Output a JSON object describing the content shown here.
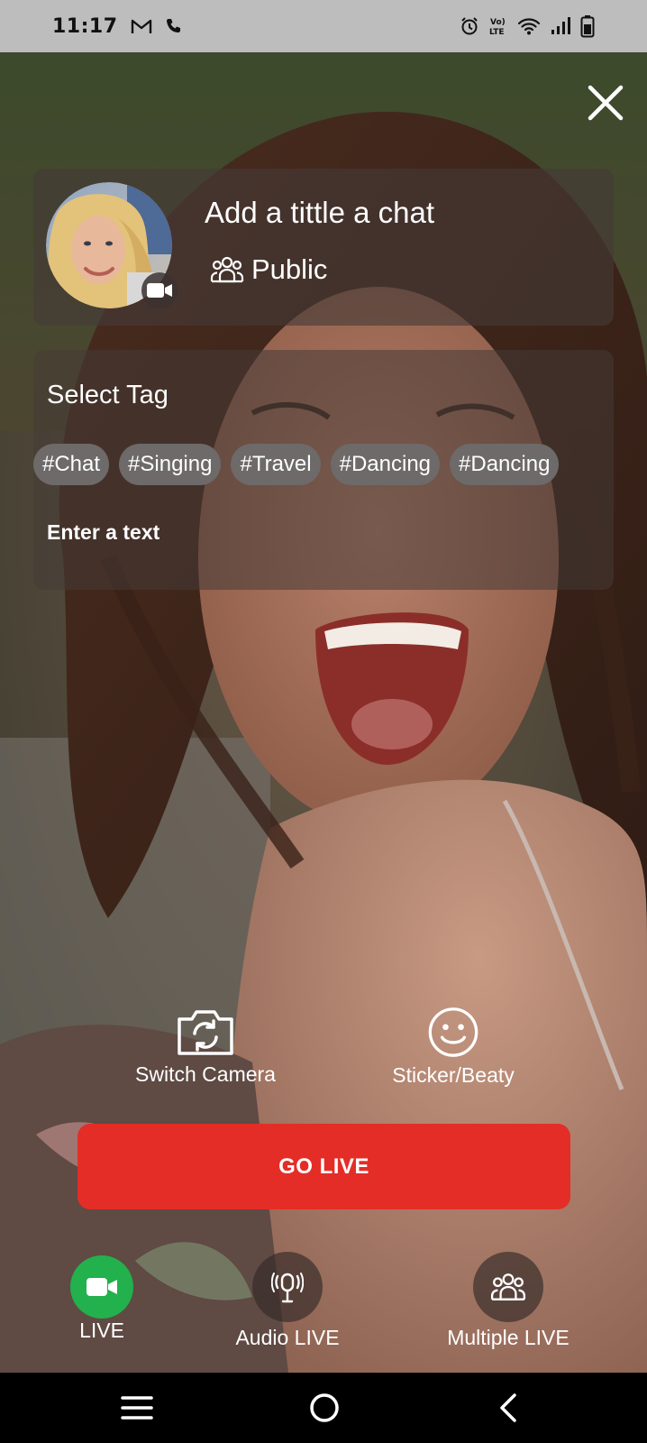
{
  "status_bar": {
    "time": "11:17",
    "left_icons": [
      "gmail-icon",
      "phone-icon"
    ],
    "right_icons": [
      "alarm-icon",
      "volte-icon",
      "wifi-icon",
      "signal-icon",
      "battery-icon"
    ],
    "volte_text": "Vo) LTE"
  },
  "stream": {
    "title": "Add a tittle a chat",
    "privacy": "Public"
  },
  "tags": {
    "label": "Select Tag",
    "items": [
      "#Chat",
      "#Singing",
      "#Travel",
      "#Dancing",
      "#Dancing"
    ],
    "text_placeholder": "Enter a text"
  },
  "tools": {
    "switch_camera": "Switch Camera",
    "sticker": "Sticker/Beaty"
  },
  "go_live": "GO LIVE",
  "modes": {
    "live": "LIVE",
    "audio": "Audio LIVE",
    "multiple": "Multiple LIVE",
    "active": "live"
  },
  "colors": {
    "accent": "#e52d27",
    "live_active": "#22b14c",
    "status_bar": "#bdbdbd",
    "chip": "#6d6a69"
  }
}
